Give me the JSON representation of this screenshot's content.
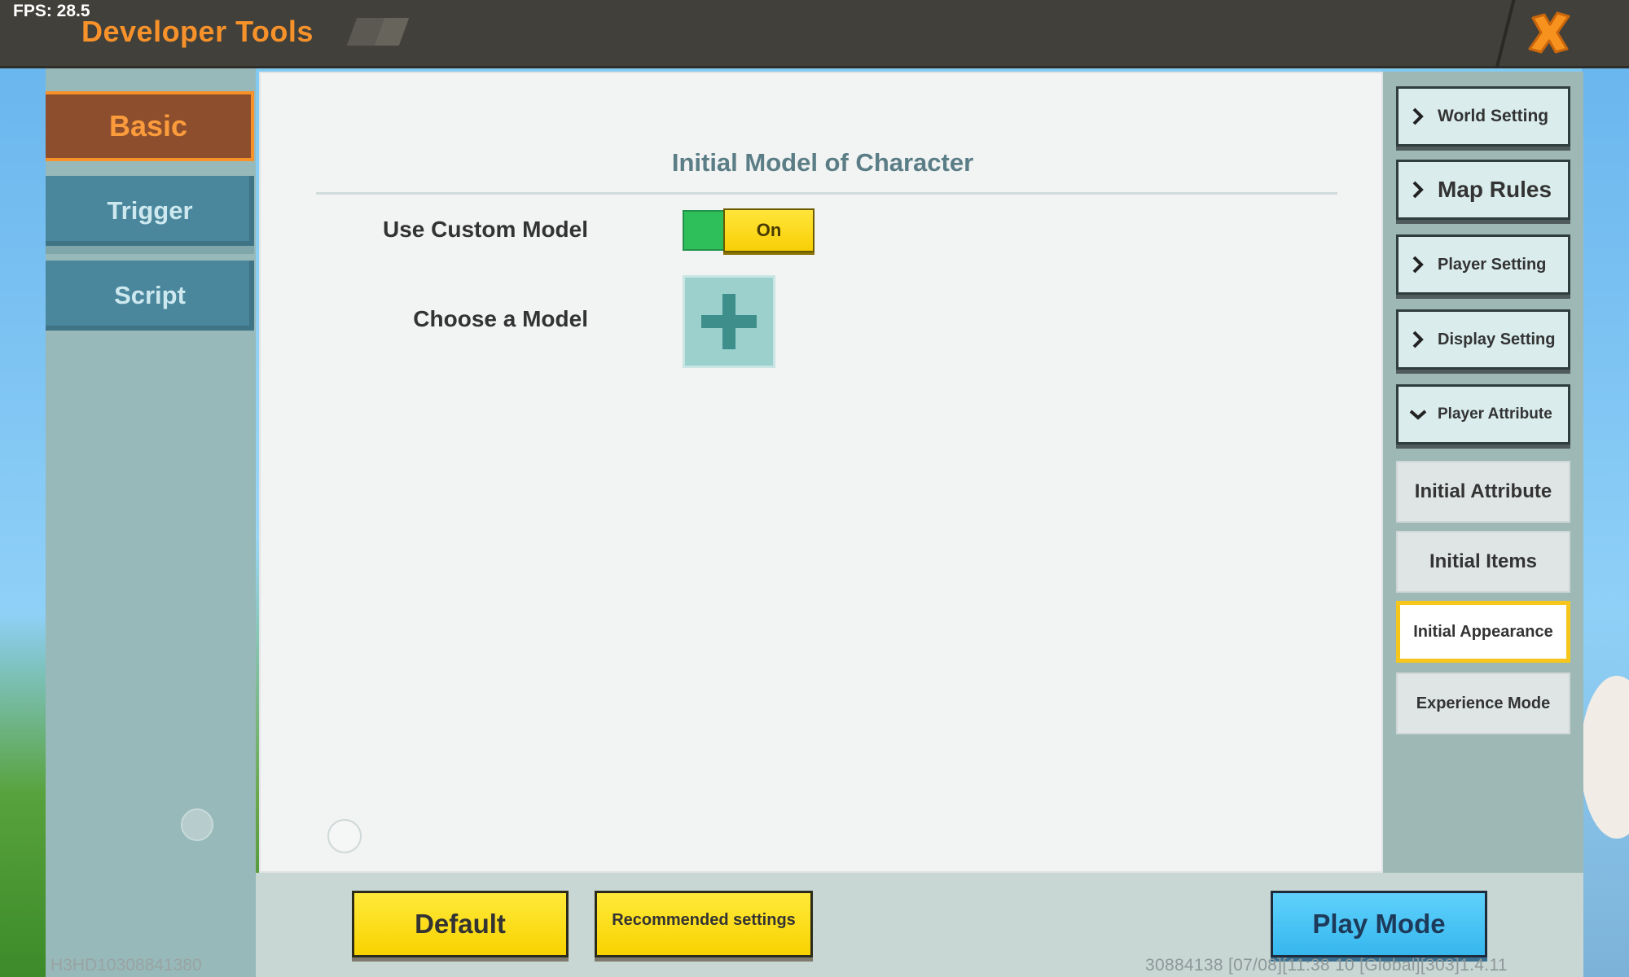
{
  "hud": {
    "fps": "FPS: 28.5"
  },
  "header": {
    "title": "Developer Tools",
    "close_icon": "close-x-icon"
  },
  "sidebar": {
    "tabs": [
      {
        "label": "Basic",
        "active": true
      },
      {
        "label": "Trigger",
        "active": false
      },
      {
        "label": "Script",
        "active": false
      }
    ]
  },
  "main": {
    "section_title": "Initial Model of Character",
    "rows": [
      {
        "label": "Use Custom Model",
        "control": "toggle",
        "value": "On"
      },
      {
        "label": "Choose a Model",
        "control": "add-button",
        "icon": "plus-icon"
      }
    ]
  },
  "right_panel": {
    "categories": [
      {
        "label": "World Setting",
        "icon": "chevron-right-icon"
      },
      {
        "label": "Map Rules",
        "icon": "chevron-right-icon"
      },
      {
        "label": "Player Setting",
        "icon": "chevron-right-icon"
      },
      {
        "label": "Display Setting",
        "icon": "chevron-right-icon"
      },
      {
        "label": "Player Attribute",
        "icon": "chevron-down-icon",
        "expanded": true
      }
    ],
    "subitems": [
      {
        "label": "Initial Attribute",
        "active": false
      },
      {
        "label": "Initial Items",
        "active": false
      },
      {
        "label": "Initial Appearance",
        "active": true
      },
      {
        "label": "Experience Mode",
        "active": false
      }
    ]
  },
  "bottom": {
    "default_label": "Default",
    "recommended_label": "Recommended settings",
    "play_label": "Play Mode"
  },
  "footer": {
    "device_id": "H3HD10308841380",
    "build_info": "30884138   [07/08][11:38 10   [Global][303]1.4.11"
  },
  "colors": {
    "accent_orange": "#f7922b",
    "active_tab_bg": "#8c4e2c",
    "tab_teal": "#4a879c",
    "toggle_green": "#2fbf5a",
    "button_yellow": "#f8d200",
    "play_blue": "#36b7ee",
    "highlight_gold": "#f6c61c"
  }
}
